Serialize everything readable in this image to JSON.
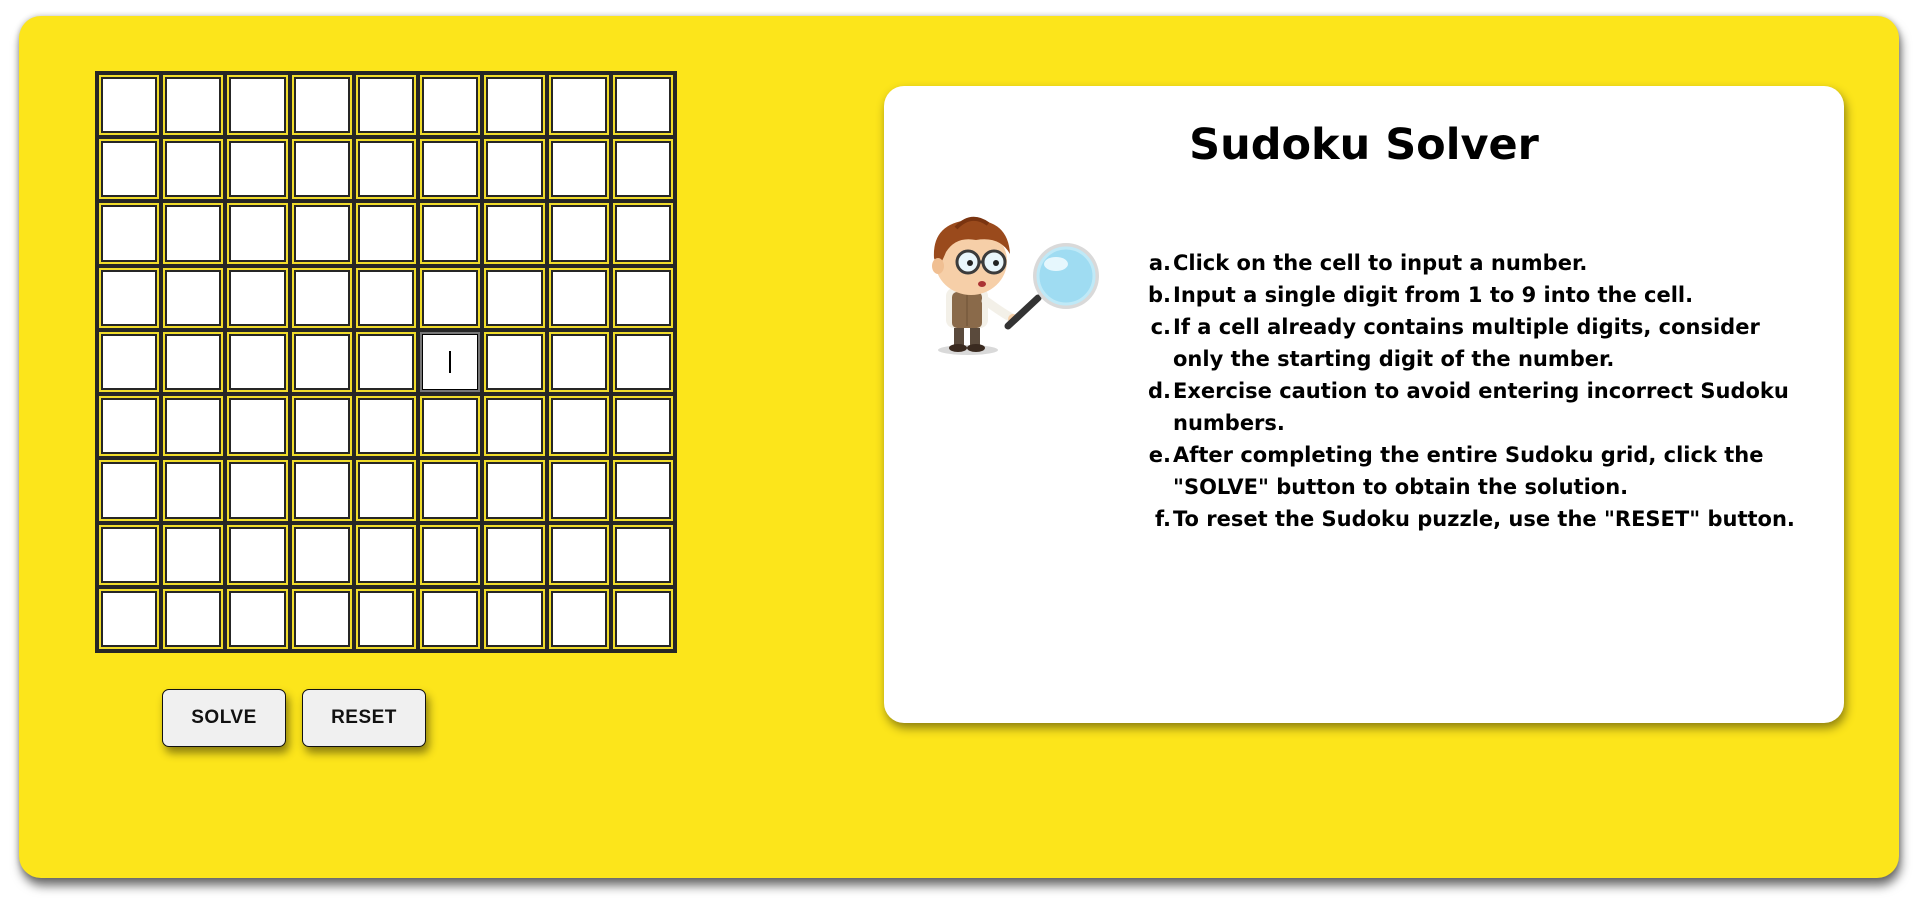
{
  "grid": {
    "rows": 9,
    "cols": 9,
    "values": [
      [
        "",
        "",
        "",
        "",
        "",
        "",
        "",
        "",
        ""
      ],
      [
        "",
        "",
        "",
        "",
        "",
        "",
        "",
        "",
        ""
      ],
      [
        "",
        "",
        "",
        "",
        "",
        "",
        "",
        "",
        ""
      ],
      [
        "",
        "",
        "",
        "",
        "",
        "",
        "",
        "",
        ""
      ],
      [
        "",
        "",
        "",
        "",
        "",
        "",
        "",
        "",
        ""
      ],
      [
        "",
        "",
        "",
        "",
        "",
        "",
        "",
        "",
        ""
      ],
      [
        "",
        "",
        "",
        "",
        "",
        "",
        "",
        "",
        ""
      ],
      [
        "",
        "",
        "",
        "",
        "",
        "",
        "",
        "",
        ""
      ],
      [
        "",
        "",
        "",
        "",
        "",
        "",
        "",
        "",
        ""
      ]
    ],
    "focused_cell": {
      "row": 5,
      "col": 6
    }
  },
  "buttons": {
    "solve_label": "SOLVE",
    "reset_label": "RESET"
  },
  "card": {
    "title": "Sudoku Solver",
    "mascot_icon": "boy-with-magnifying-glass-icon",
    "instructions": [
      {
        "marker": "a.",
        "text": "Click on the cell to input a number."
      },
      {
        "marker": "b.",
        "text": "Input a single digit from 1 to 9 into the cell."
      },
      {
        "marker": "c.",
        "text": "If a cell already contains multiple digits, consider only the starting digit of the number."
      },
      {
        "marker": "d.",
        "text": "Exercise caution to avoid entering incorrect Sudoku numbers."
      },
      {
        "marker": "e.",
        "text": "After completing the entire Sudoku grid, click the \"SOLVE\" button to obtain the solution."
      },
      {
        "marker": "f.",
        "text": "To reset the Sudoku puzzle, use the \"RESET\" button."
      }
    ]
  },
  "colors": {
    "background": "#fce51b",
    "grid_frame": "#262626",
    "cell_border": "#f0dc2a",
    "card": "#ffffff",
    "button": "#f0f0f0"
  }
}
